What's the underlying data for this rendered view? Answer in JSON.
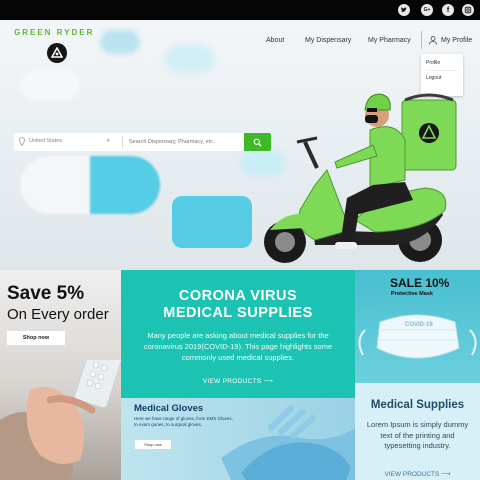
{
  "topbar": {
    "social": [
      {
        "icon": "twitter-icon",
        "label": "t"
      },
      {
        "icon": "google-plus-icon",
        "label": "G+"
      },
      {
        "icon": "facebook-icon",
        "label": "f"
      },
      {
        "icon": "instagram-icon",
        "label": "◎"
      }
    ]
  },
  "header": {
    "logo": "GREEN RYDER",
    "nav": {
      "about": "About",
      "dispensary": "My Dispensary",
      "pharmacy": "My Pharmacy",
      "profile": "My Profile"
    },
    "profile_menu": {
      "profile": "Profile",
      "logout": "Logout"
    }
  },
  "search": {
    "location": "United States",
    "placeholder": "Search Dispensary, Pharmacy, etc."
  },
  "promos": {
    "save": {
      "line1": "Save 5%",
      "line2": "On Every order",
      "button": "Shop now"
    },
    "corona": {
      "title_line1": "CORONA VIRUS",
      "title_line2": "MEDICAL SUPPLIES",
      "body": "Many people are asking about medical supplies for the coronavirus 2019(COVID-19). This page highlights some commonly used medical supplies.",
      "link": "VIEW PRODUCTS"
    },
    "mask": {
      "line1": "SALE 10%",
      "line2": "Protective Mask",
      "mask_text": "COVID-19"
    },
    "gloves": {
      "title": "Medical Gloves",
      "body": "Here we have range of gloves, from EMS Gloves, to exam gones, to surgical gloves.",
      "button": "Shop now"
    },
    "supplies": {
      "title": "Medical Supplies",
      "body": "Lorem Ipsum is simply dummy text of the printing and typesetting industry.",
      "link": "VIEW PRODUCTS"
    }
  },
  "colors": {
    "brand_green": "#5fb931",
    "teal": "#1dc3b2",
    "search_green": "#3fb928"
  }
}
